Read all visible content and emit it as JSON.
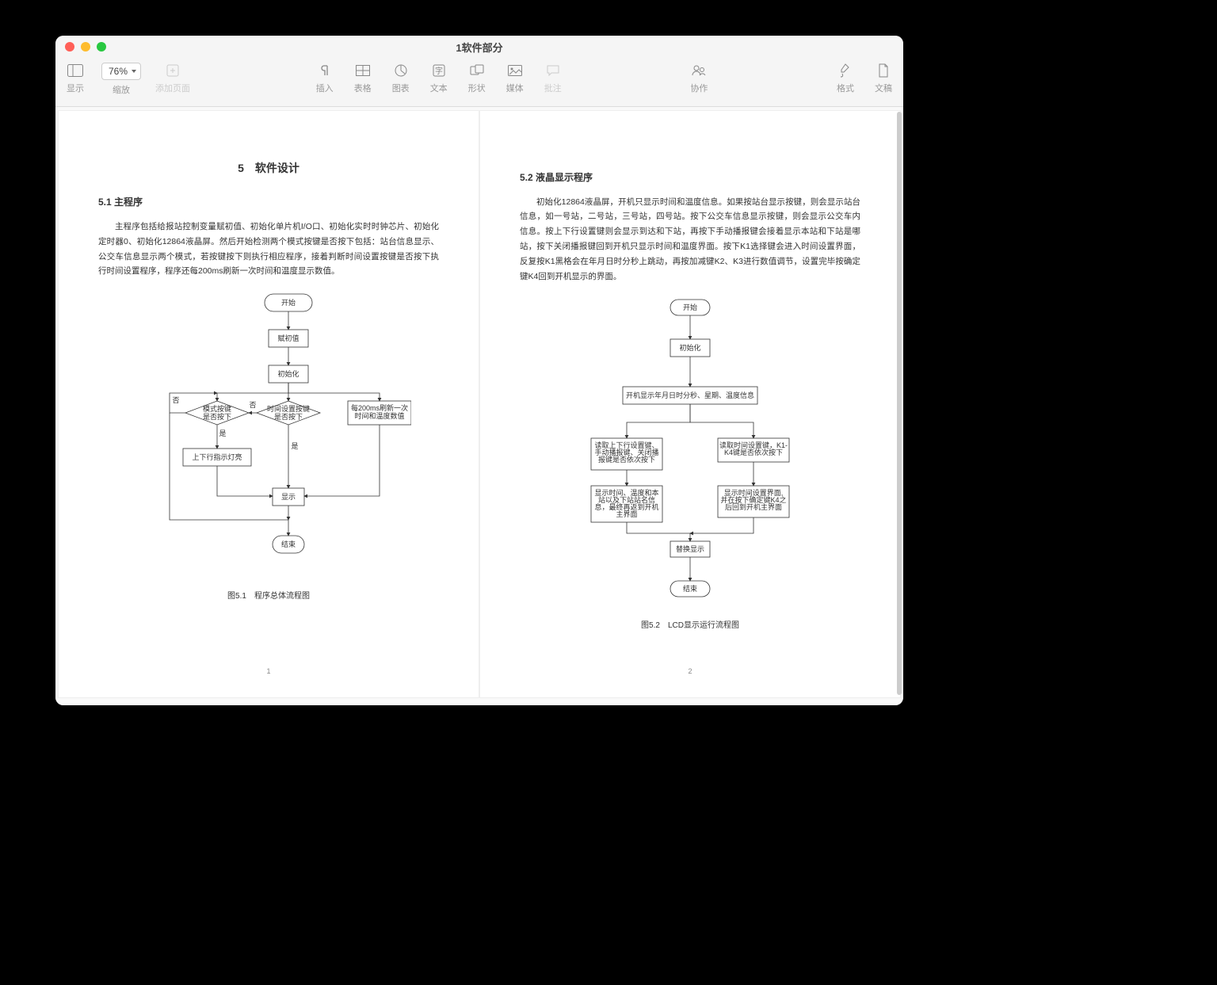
{
  "window": {
    "title": "1软件部分"
  },
  "toolbar": {
    "view": "显示",
    "zoom": "缩放",
    "zoom_value": "76%",
    "add_page": "添加页面",
    "insert": "插入",
    "table": "表格",
    "chart": "图表",
    "text": "文本",
    "shape": "形状",
    "media": "媒体",
    "comment": "批注",
    "collab": "协作",
    "format": "格式",
    "document": "文稿"
  },
  "page1": {
    "h3": "5　软件设计",
    "h4": "5.1 主程序",
    "body": "主程序包括给报站控制变量赋初值、初始化单片机I/O口、初始化实时时钟芯片、初始化定时器0、初始化12864液晶屏。然后开始检测两个模式按键是否按下包括：站台信息显示、公交车信息显示两个模式，若按键按下则执行相应程序，接着判断时间设置按键是否按下执行时间设置程序，程序还每200ms刷新一次时间和温度显示数值。",
    "fc": {
      "start": "开始",
      "init_val": "赋初值",
      "init": "初始化",
      "decision1": "模式按键\n是否按下",
      "decision2": "时间设置按键\n是否按下",
      "yes": "是",
      "no": "否",
      "refresh": "每200ms刷新一次\n时间和温度数值",
      "led": "上下行指示灯亮",
      "display": "显示",
      "end": "结束"
    },
    "caption": "图5.1　程序总体流程图",
    "num": "1"
  },
  "page2": {
    "h4": "5.2 液晶显示程序",
    "body": "初始化12864液晶屏，开机只显示时间和温度信息。如果按站台显示按键，则会显示站台信息，如一号站，二号站，三号站，四号站。按下公交车信息显示按键，则会显示公交车内信息。按上下行设置键则会显示到达和下站，再按下手动播报键会接着显示本站和下站是哪站，按下关闭播报键回到开机只显示时间和温度界面。按下K1选择键会进入时间设置界面，反复按K1黑格会在年月日时分秒上跳动，再按加减键K2、K3进行数值调节，设置完毕按确定键K4回到开机显示的界面。",
    "fc": {
      "start": "开始",
      "init": "初始化",
      "boot": "开机显示年月日时分秒、星期、温度信息",
      "left_read": "读取上下行设置键、\n手动播报键、关闭播\n报键是否依次按下",
      "right_read": "读取时间设置键，K1-\nK4键是否依次按下",
      "left_show": "显示时间、温度和本\n站以及下站站名信\n息，最终再返到开机\n主界面",
      "right_show": "显示时间设置界面,\n并在按下确定键K4之\n后回到开机主界面",
      "swap": "替换显示",
      "end": "结束"
    },
    "caption": "图5.2　LCD显示运行流程图",
    "num": "2"
  }
}
